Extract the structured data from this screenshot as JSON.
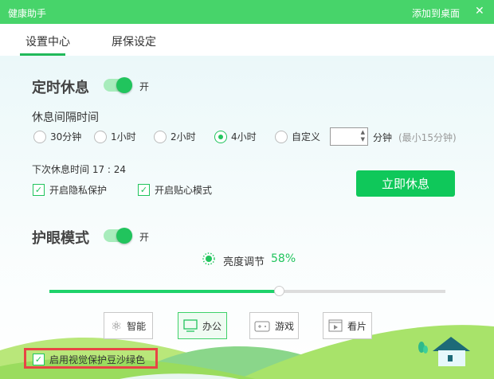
{
  "titlebar": {
    "title": "健康助手",
    "add_desktop": "添加到桌面",
    "close": "✕"
  },
  "tabs": [
    {
      "label": "设置中心",
      "active": true
    },
    {
      "label": "屏保设定",
      "active": false
    }
  ],
  "rest": {
    "heading": "定时休息",
    "toggle_on": true,
    "toggle_label": "开",
    "interval_label": "休息间隔时间",
    "options": [
      "30分钟",
      "1小时",
      "2小时",
      "4小时",
      "自定义"
    ],
    "selected": "4小时",
    "custom_value": "",
    "custom_unit": "分钟",
    "custom_hint": "(最小15分钟)",
    "next_rest": "下次休息时间 17 : 24",
    "privacy": {
      "label": "开启隐私保护",
      "checked": true
    },
    "care": {
      "label": "开启贴心模式",
      "checked": true
    },
    "rest_now": "立即休息"
  },
  "eye": {
    "heading": "护眼模式",
    "toggle_on": true,
    "toggle_label": "开",
    "brightness_label": "亮度调节",
    "brightness": "58%",
    "brightness_value": 58,
    "modes": [
      {
        "label": "智能",
        "icon": "atom-icon"
      },
      {
        "label": "办公",
        "icon": "monitor-icon",
        "active": true
      },
      {
        "label": "游戏",
        "icon": "gamepad-icon"
      },
      {
        "label": "看片",
        "icon": "film-icon"
      }
    ],
    "bean_green": {
      "label": "启用视觉保护豆沙绿色",
      "checked": true
    }
  },
  "colors": {
    "accent": "#21c45d",
    "titlebar": "#47d46a",
    "highlight": "#e84545"
  }
}
